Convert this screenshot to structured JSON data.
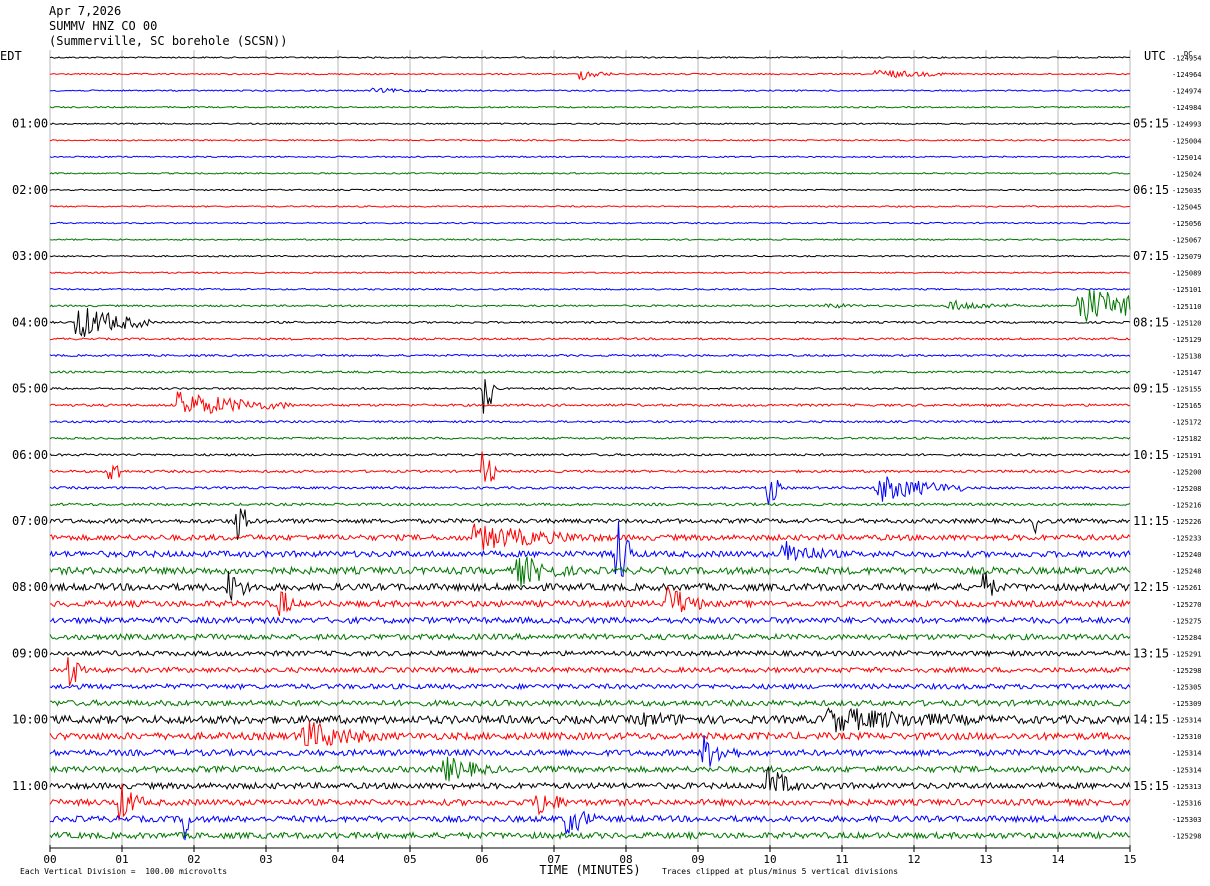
{
  "header": {
    "date": "Apr 7,2026",
    "station": "SUMMV HNZ CO 00",
    "location": "(Summerville, SC borehole (SCSN))"
  },
  "chart_data": {
    "type": "line",
    "title": "",
    "left_label": "EDT",
    "right_label": "UTC",
    "right_top_label": "DC",
    "xlabel": "TIME (MINUTES)",
    "xlim": [
      0,
      15
    ],
    "x_ticks": [
      "00",
      "01",
      "02",
      "03",
      "04",
      "05",
      "06",
      "07",
      "08",
      "09",
      "10",
      "11",
      "12",
      "13",
      "14",
      "15"
    ],
    "left_hour_labels": [
      "01:00",
      "02:00",
      "03:00",
      "04:00",
      "05:00",
      "06:00",
      "07:00",
      "08:00",
      "09:00",
      "10:00",
      "11:00"
    ],
    "right_hour_labels": [
      "05:15",
      "06:15",
      "07:15",
      "08:15",
      "09:15",
      "10:15",
      "11:15",
      "12:15",
      "13:15",
      "14:15",
      "15:15"
    ],
    "trace_count": 48,
    "trace_colors": [
      "#000000",
      "#ff0000",
      "#0000ff",
      "#007700"
    ],
    "dc_offsets": [
      "-124954",
      "-124964",
      "-124974",
      "-124984",
      "-124993",
      "-125004",
      "-125014",
      "-125024",
      "-125035",
      "-125045",
      "-125056",
      "-125067",
      "-125079",
      "-125089",
      "-125101",
      "-125110",
      "-125120",
      "-125129",
      "-125138",
      "-125147",
      "-125155",
      "-125165",
      "-125172",
      "-125182",
      "-125191",
      "-125200",
      "-125208",
      "-125216",
      "-125226",
      "-125233",
      "-125240",
      "-125248",
      "-125261",
      "-125270",
      "-125275",
      "-125284",
      "-125291",
      "-125298",
      "-125305",
      "-125309",
      "-125314",
      "-125310",
      "-125314",
      "-125314",
      "-125313",
      "-125316",
      "-125303",
      "-125298"
    ],
    "trace_activity": [
      0.7,
      0.7,
      0.7,
      0.7,
      0.7,
      0.7,
      0.7,
      0.7,
      0.7,
      0.7,
      0.7,
      0.7,
      0.7,
      0.7,
      0.8,
      0.9,
      1,
      1,
      1,
      1,
      1,
      1.2,
      1,
      1,
      1.1,
      1.2,
      1.2,
      1.3,
      2.2,
      2.8,
      3,
      3.5,
      3.5,
      3,
      3,
      2.8,
      2.5,
      2.5,
      2.5,
      2.8,
      4,
      3.5,
      3,
      3,
      3,
      3,
      3,
      3
    ],
    "bursts": [
      {
        "trace": 1,
        "minute": 7.4,
        "dur": 0.4,
        "amp": 6
      },
      {
        "trace": 1,
        "minute": 11.5,
        "dur": 1.2,
        "amp": 5
      },
      {
        "trace": 2,
        "minute": 4.5,
        "dur": 1.5,
        "amp": 2.5
      },
      {
        "trace": 15,
        "minute": 14.3,
        "dur": 1.3,
        "amp": 22
      },
      {
        "trace": 15,
        "minute": 12.5,
        "dur": 1.0,
        "amp": 6
      },
      {
        "trace": 15,
        "minute": 10.8,
        "dur": 0.8,
        "amp": 3
      },
      {
        "trace": 16,
        "minute": 0.4,
        "dur": 1.0,
        "amp": 18
      },
      {
        "trace": 20,
        "minute": 6.05,
        "dur": 0.15,
        "amp": 28
      },
      {
        "trace": 21,
        "minute": 1.8,
        "dur": 1.6,
        "amp": 14
      },
      {
        "trace": 25,
        "minute": 0.85,
        "dur": 0.15,
        "amp": 18
      },
      {
        "trace": 25,
        "minute": 6.05,
        "dur": 0.15,
        "amp": 20
      },
      {
        "trace": 26,
        "minute": 11.5,
        "dur": 1.2,
        "amp": 15
      },
      {
        "trace": 26,
        "minute": 10.0,
        "dur": 0.15,
        "amp": 18
      },
      {
        "trace": 28,
        "minute": 2.6,
        "dur": 0.2,
        "amp": 22
      },
      {
        "trace": 28,
        "minute": 13.7,
        "dur": 0.1,
        "amp": 12
      },
      {
        "trace": 29,
        "minute": 5.9,
        "dur": 2.0,
        "amp": 14
      },
      {
        "trace": 30,
        "minute": 10.2,
        "dur": 0.8,
        "amp": 15
      },
      {
        "trace": 30,
        "minute": 7.9,
        "dur": 0.2,
        "amp": 40
      },
      {
        "trace": 31,
        "minute": 6.5,
        "dur": 0.8,
        "amp": 18
      },
      {
        "trace": 32,
        "minute": 2.5,
        "dur": 0.3,
        "amp": 18
      },
      {
        "trace": 32,
        "minute": 13.0,
        "dur": 0.2,
        "amp": 16
      },
      {
        "trace": 33,
        "minute": 8.6,
        "dur": 0.5,
        "amp": 20
      },
      {
        "trace": 33,
        "minute": 3.2,
        "dur": 0.2,
        "amp": 18
      },
      {
        "trace": 37,
        "minute": 0.3,
        "dur": 0.2,
        "amp": 18
      },
      {
        "trace": 40,
        "minute": 10.8,
        "dur": 3.0,
        "amp": 14
      },
      {
        "trace": 40,
        "minute": 8.2,
        "dur": 2.4,
        "amp": 8
      },
      {
        "trace": 41,
        "minute": 3.5,
        "dur": 1.2,
        "amp": 18
      },
      {
        "trace": 42,
        "minute": 9.1,
        "dur": 0.5,
        "amp": 18
      },
      {
        "trace": 43,
        "minute": 5.5,
        "dur": 0.8,
        "amp": 14
      },
      {
        "trace": 44,
        "minute": 10.0,
        "dur": 0.4,
        "amp": 20
      },
      {
        "trace": 45,
        "minute": 1.0,
        "dur": 0.3,
        "amp": 20
      },
      {
        "trace": 45,
        "minute": 6.8,
        "dur": 0.4,
        "amp": 16
      },
      {
        "trace": 46,
        "minute": 7.2,
        "dur": 0.4,
        "amp": 18
      },
      {
        "trace": 46,
        "minute": 1.9,
        "dur": 0.1,
        "amp": 25
      }
    ]
  },
  "footer": {
    "scale_note": "Each Vertical Division =  100.00 microvolts",
    "clip_note": "Traces clipped at plus/minus 5 vertical divisions"
  }
}
